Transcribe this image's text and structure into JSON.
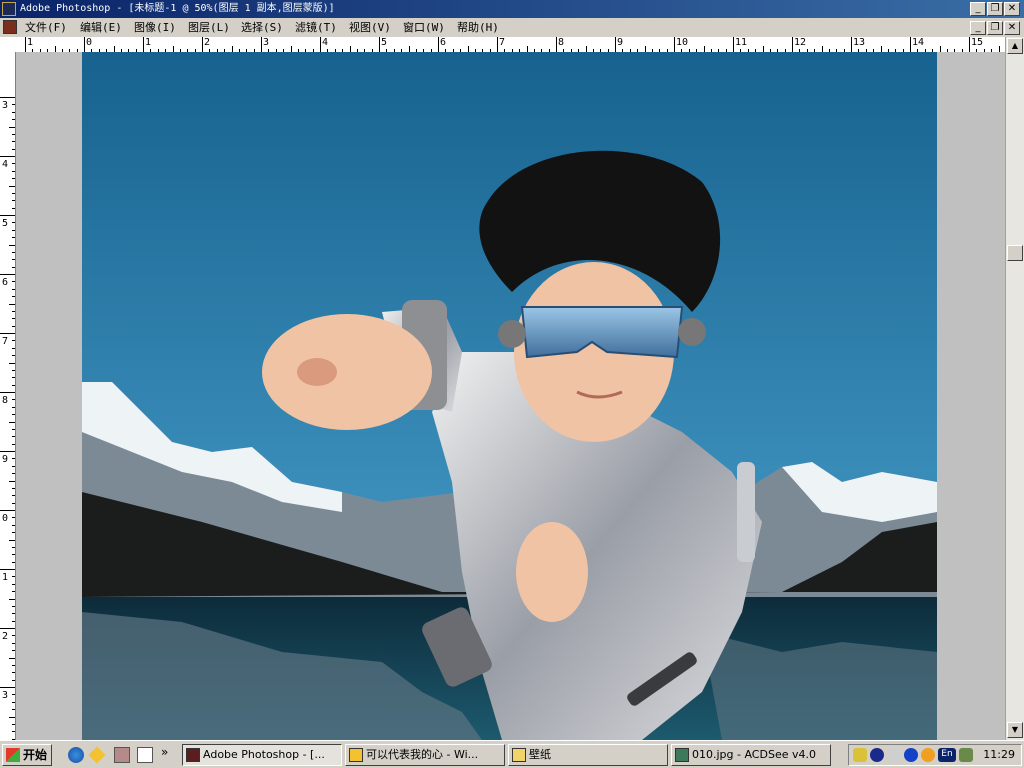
{
  "window": {
    "title": "Adobe Photoshop - [未标题-1 @ 50%(图层 1 副本,图层蒙版)]",
    "minimize": "_",
    "restore": "❐",
    "close": "✕"
  },
  "menu": {
    "items": [
      "文件(F)",
      "编辑(E)",
      "图像(I)",
      "图层(L)",
      "选择(S)",
      "滤镜(T)",
      "视图(V)",
      "窗口(W)",
      "帮助(H)"
    ]
  },
  "ruler": {
    "top_labels": [
      "1",
      "0",
      "1",
      "2",
      "3",
      "4",
      "5",
      "6",
      "7",
      "8",
      "9",
      "10",
      "11",
      "12",
      "13",
      "14",
      "15"
    ],
    "left_labels": [
      "3",
      "4",
      "5",
      "6",
      "7",
      "8",
      "9",
      "0",
      "1",
      "2",
      "3"
    ]
  },
  "canvas": {
    "subject": "child in silver suit with blue sunglasses pointing, mountain lake background"
  },
  "taskbar": {
    "start_label": "开始",
    "chevron": "»",
    "buttons": [
      "Adobe Photoshop - [...",
      "可以代表我的心 - Wi...",
      "壁纸",
      "010.jpg - ACDSee v4.0"
    ],
    "clock": "11:29",
    "lang": "En"
  },
  "colors": {
    "title_gradient_start": "#0a246a",
    "title_gradient_end": "#3a6ea5",
    "sky_top": "#1f6f9e",
    "sky_bottom": "#4a9fcf",
    "lake": "#0f2f40"
  }
}
